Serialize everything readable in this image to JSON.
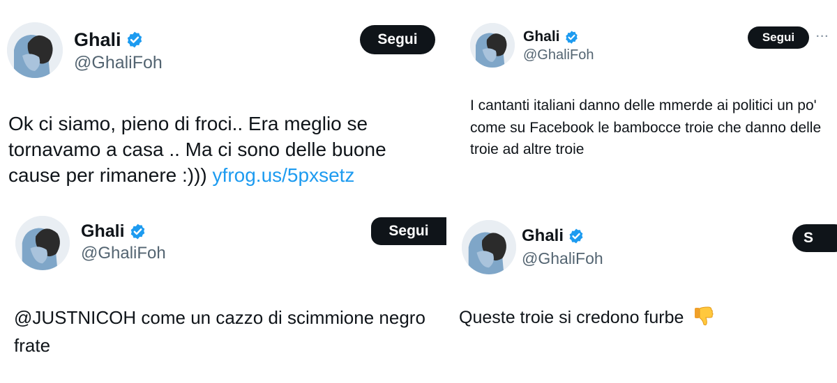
{
  "tweets": [
    {
      "name": "Ghali",
      "handle": "@GhaliFoh",
      "follow_label": "Segui",
      "text": "Ok ci siamo, pieno di froci.. Era meglio se tornavamo a casa .. Ma ci sono delle buone cause per rimanere :)))",
      "link": "yfrog.us/5pxsetz"
    },
    {
      "name": "Ghali",
      "handle": "@GhaliFoh",
      "follow_label": "Segui",
      "more_label": "···",
      "text": "I cantanti italiani danno delle mmerde ai politici un po' come su Facebook le bambocce troie che danno delle troie ad altre troie"
    },
    {
      "name": "Ghali",
      "handle": "@GhaliFoh",
      "follow_label": "Segui",
      "text": "@JUSTNICOH come un cazzo di scimmione negro frate"
    },
    {
      "name": "Ghali",
      "handle": "@GhaliFoh",
      "follow_label": "S",
      "text": "Queste troie si credono furbe",
      "emoji": "thumbs-down-icon"
    }
  ],
  "colors": {
    "verified": "#1d9bf0",
    "link": "#1d9bf0",
    "handle": "#536471",
    "follow_bg": "#0f1419"
  }
}
